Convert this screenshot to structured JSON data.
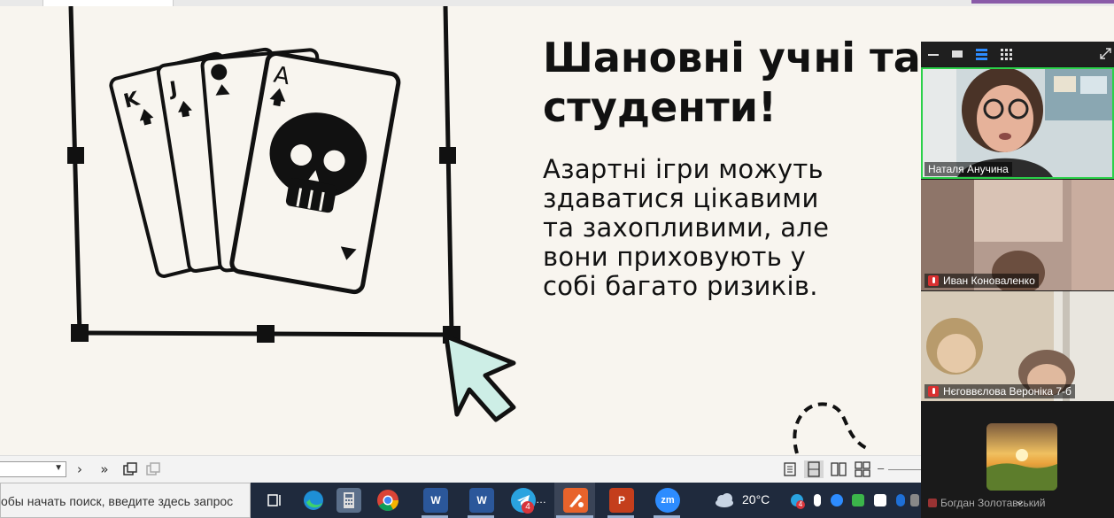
{
  "slide": {
    "title": "Шановні учні та\nстуденти!",
    "body_lines": [
      "Азартні ігри можуть",
      "здаватися цікавими",
      "та захопливими, але",
      "вони приховують у",
      "собі багато ризиків."
    ],
    "card_letters": [
      "K",
      "J",
      "A"
    ]
  },
  "zoom": {
    "participants": [
      {
        "name": "Наталя Анучина",
        "muted": false,
        "active": true
      },
      {
        "name": "Иван Коноваленко",
        "muted": true,
        "active": false
      },
      {
        "name": "Нєговвєлова Вероніка 7-б",
        "muted": true,
        "active": false
      },
      {
        "name": "Богдан Золотавський",
        "muted": true,
        "active": false
      }
    ]
  },
  "taskbar": {
    "search_placeholder": "обы начать поиск, введите здесь запрос",
    "telegram_badge": "4",
    "zoom_label": "zm",
    "word_label": "W",
    "ppt_label": "P",
    "temperature": "20°C",
    "tray_badge": "4"
  },
  "colors": {
    "taskbar_bg": "#1f2a3d",
    "active_speaker": "#2bd14a",
    "slide_bg": "#f8f5ef",
    "cursor_fill": "#cdeee6"
  }
}
